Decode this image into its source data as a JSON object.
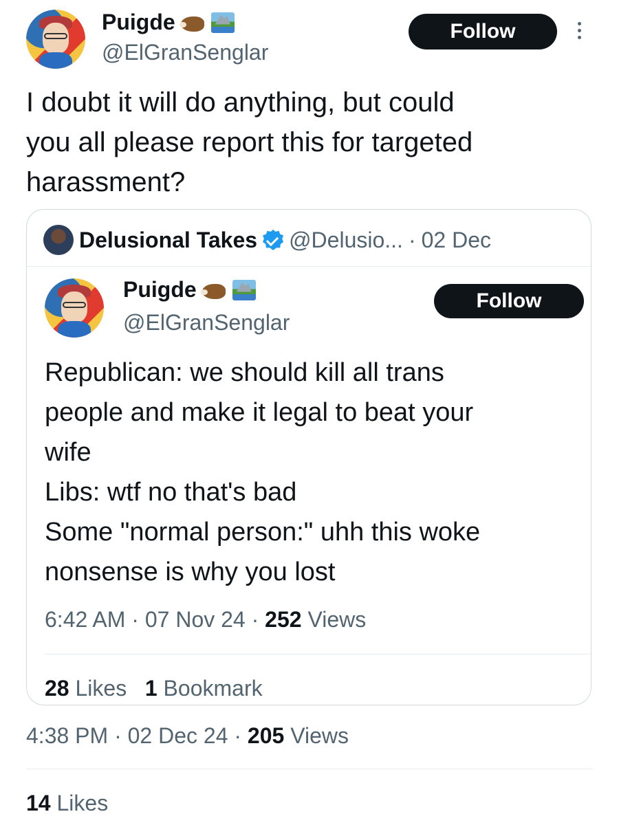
{
  "tweet": {
    "author_name": "Puigde",
    "author_emoji": [
      "boar-emoji",
      "national-park-emoji"
    ],
    "author_handle": "@ElGranSenglar",
    "follow_label": "Follow",
    "text": "I doubt it will do anything, but could\nyou all please report this for targeted\nharassment?",
    "time": "4:38 PM",
    "sep": "·",
    "date": "02 Dec 24",
    "views_count": "205",
    "views_label": "Views",
    "likes_count": "14",
    "likes_label": "Likes"
  },
  "quote": {
    "author_name": "Delusional Takes",
    "author_handle": "@Delusio...",
    "sep": "·",
    "date": "02 Dec",
    "inner": {
      "author_name": "Puigde",
      "author_handle": "@ElGranSenglar",
      "follow_label": "Follow",
      "text": "Republican: we should kill all trans\npeople and make it legal to beat your\nwife\nLibs: wtf no that's bad\nSome \"normal person:\" uhh this woke\nnonsense is why you lost",
      "time": "6:42 AM",
      "sep": "·",
      "date": "07 Nov 24",
      "views_count": "252",
      "views_label": "Views",
      "likes_count": "28",
      "likes_label": "Likes",
      "bookmarks_count": "1",
      "bookmarks_label": "Bookmark"
    }
  },
  "colors": {
    "text_primary": "#0f1419",
    "text_secondary": "#536471",
    "verified": "#1d9bf0",
    "border": "#cfd9de"
  }
}
